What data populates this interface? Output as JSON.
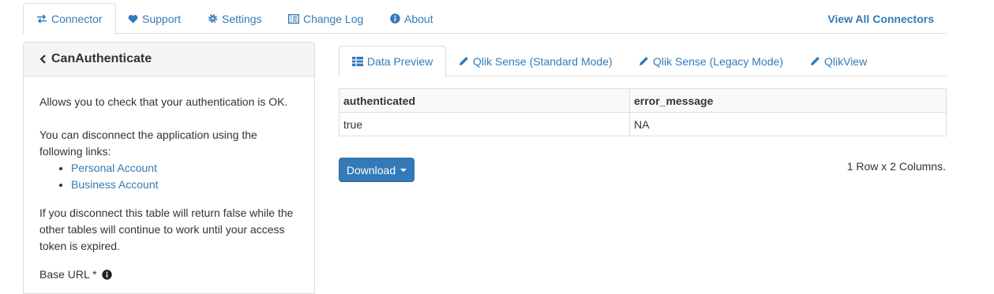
{
  "top_nav": {
    "tabs": [
      {
        "label": "Connector",
        "icon": "exchange-icon"
      },
      {
        "label": "Support",
        "icon": "heart-icon"
      },
      {
        "label": "Settings",
        "icon": "gear-icon"
      },
      {
        "label": "Change Log",
        "icon": "list-alt-icon"
      },
      {
        "label": "About",
        "icon": "info-circle-icon"
      }
    ],
    "active_tab": "Connector",
    "view_all": "View All Connectors"
  },
  "panel": {
    "title": "CanAuthenticate",
    "description": "Allows you to check that your authentication is OK.",
    "disconnect_text": "You can disconnect the application using the following links:",
    "links": [
      "Personal Account",
      "Business Account"
    ],
    "warning_text": "If you disconnect this table will return false while the other tables will continue to work until your access token is expired.",
    "base_url_label": "Base URL *"
  },
  "sub_tabs": {
    "tabs": [
      {
        "label": "Data Preview",
        "icon": "table-icon"
      },
      {
        "label": "Qlik Sense (Standard Mode)",
        "icon": "pencil-icon"
      },
      {
        "label": "Qlik Sense (Legacy Mode)",
        "icon": "pencil-icon"
      },
      {
        "label": "QlikView",
        "icon": "pencil-icon"
      }
    ],
    "active_tab": "Data Preview"
  },
  "table": {
    "columns": [
      "authenticated",
      "error_message"
    ],
    "rows": [
      [
        "true",
        "NA"
      ]
    ]
  },
  "download_label": "Download",
  "row_summary": "1 Row x 2 Columns.",
  "colors": {
    "link": "#337ab7",
    "button": "#337ab7",
    "border": "#dddddd"
  }
}
